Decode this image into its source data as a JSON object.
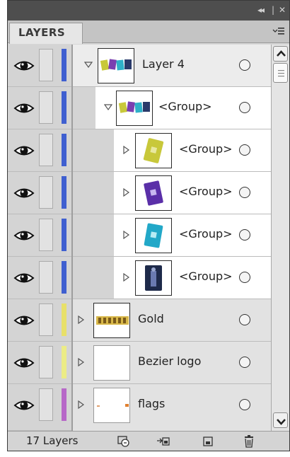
{
  "panel": {
    "title_controls": {
      "collapse": "◂◂",
      "close": "✕"
    },
    "tab_label": "LAYERS",
    "menu_icon": "panel-menu-icon"
  },
  "layers": [
    {
      "name": "Layer 4",
      "kind": "layer",
      "expanded": true,
      "color": "#3f5fd0",
      "thumb": "cards-icon"
    },
    {
      "name": "<Group>",
      "kind": "group",
      "expanded": true,
      "color": "#3f5fd0",
      "thumb": "cards-icon"
    },
    {
      "name": "<Group>",
      "kind": "group",
      "expanded": false,
      "color": "#3f5fd0",
      "thumb": "yellow-card-icon"
    },
    {
      "name": "<Group>",
      "kind": "group",
      "expanded": false,
      "color": "#3f5fd0",
      "thumb": "purple-card-icon"
    },
    {
      "name": "<Group>",
      "kind": "group",
      "expanded": false,
      "color": "#3f5fd0",
      "thumb": "cyan-card-icon"
    },
    {
      "name": "<Group>",
      "kind": "group",
      "expanded": false,
      "color": "#3f5fd0",
      "thumb": "dark-card-icon"
    },
    {
      "name": "Gold",
      "kind": "layer",
      "expanded": false,
      "color": "#e8e06a",
      "thumb": "gold-text-icon"
    },
    {
      "name": "Bezier logo",
      "kind": "layer",
      "expanded": false,
      "color": "#ecec86",
      "thumb": "blank-icon"
    },
    {
      "name": "flags",
      "kind": "layer",
      "expanded": false,
      "color": "#b768c8",
      "thumb": "flags-icon"
    }
  ],
  "footer": {
    "count_label": "17 Layers",
    "buttons": [
      "locate-object-icon",
      "make-clipping-mask-icon",
      "new-sublayer-icon",
      "new-layer-icon",
      "delete-layer-icon"
    ]
  }
}
